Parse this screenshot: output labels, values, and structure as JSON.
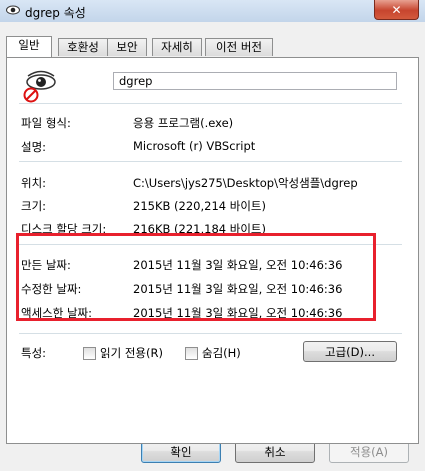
{
  "window": {
    "title": "dgrep 속성",
    "close_glyph": "✕"
  },
  "tabs": [
    {
      "label": "일반",
      "active": true
    },
    {
      "label": "호환성",
      "active": false
    },
    {
      "label": "보안",
      "active": false
    },
    {
      "label": "자세히",
      "active": false
    },
    {
      "label": "이전 버전",
      "active": false
    }
  ],
  "general": {
    "name_value": "dgrep",
    "rows": [
      {
        "label": "파일 형식:",
        "value": "응용 프로그램(.exe)"
      },
      {
        "label": "설명:",
        "value": "Microsoft (r) VBScript"
      },
      {
        "label": "위치:",
        "value": "C:\\Users\\jys275\\Desktop\\악성샘플\\dgrep"
      },
      {
        "label": "크기:",
        "value": "215KB (220,214 바이트)"
      },
      {
        "label": "디스크 할당 크기:",
        "value": "216KB (221,184 바이트)"
      },
      {
        "label": "만든 날짜:",
        "value": "2015년 11월 3일 화요일, 오전 10:46:36"
      },
      {
        "label": "수정한 날짜:",
        "value": "2015년 11월 3일 화요일, 오전 10:46:36"
      },
      {
        "label": "액세스한 날짜:",
        "value": "2015년 11월 3일 화요일, 오전 10:46:36"
      }
    ],
    "attributes_label": "특성:",
    "readonly_label": "읽기 전용(R)",
    "hidden_label": "숨김(H)",
    "advanced_button": "고급(D)..."
  },
  "footer": {
    "ok": "확인",
    "cancel": "취소",
    "apply": "적용(A)"
  },
  "colors": {
    "highlight_border": "#e8202d",
    "titlebar": "#c9d9ec"
  }
}
